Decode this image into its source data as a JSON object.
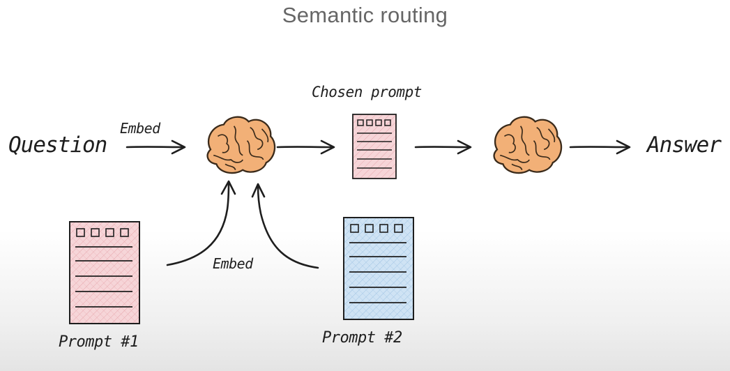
{
  "title": "Semantic routing",
  "labels": {
    "question": "Question",
    "embed_top": "Embed",
    "chosen_prompt": "Chosen prompt",
    "answer": "Answer",
    "embed_bottom": "Embed",
    "prompt1": "Prompt #1",
    "prompt2": "Prompt #2"
  },
  "icons": {
    "model": "brain-icon",
    "document": "document-icon"
  },
  "colors": {
    "brain_fill": "#f2b077",
    "brain_stroke": "#3a2a1a",
    "prompt1_fill": "#f6d5d8",
    "prompt1_hatch": "#e7a8ae",
    "prompt2_fill": "#cfe3f4",
    "prompt2_hatch": "#9fc3e2",
    "chosen_fill": "#f6d5d8",
    "ink": "#1e1e1e"
  }
}
